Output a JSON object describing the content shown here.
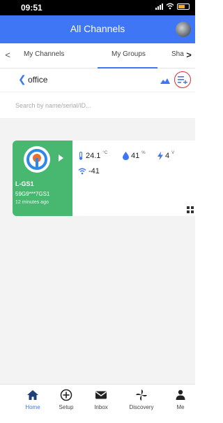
{
  "status_bar": {
    "time": "09:51"
  },
  "header": {
    "title": "All Channels"
  },
  "tabs": [
    {
      "label": "My Channels"
    },
    {
      "label": "My Groups"
    },
    {
      "label": "Sha"
    }
  ],
  "group": {
    "name": "office"
  },
  "search": {
    "placeholder": "Search by name/serial/ID..."
  },
  "device": {
    "name": "L-GS1",
    "serial": "59G9***7GS1",
    "updated": "12 minutes ago",
    "temperature": "24.1",
    "temperature_unit": "°C",
    "humidity": "41",
    "humidity_unit": "%",
    "voltage": "4",
    "voltage_unit": "V",
    "signal": "-41"
  },
  "nav": [
    {
      "label": "Home",
      "icon": "home-icon"
    },
    {
      "label": "Setup",
      "icon": "plus-circle-icon"
    },
    {
      "label": "Inbox",
      "icon": "envelope-icon"
    },
    {
      "label": "Discovery",
      "icon": "pinwheel-icon"
    },
    {
      "label": "Me",
      "icon": "person-icon"
    }
  ],
  "colors": {
    "accent": "#3e76f6",
    "device_card": "#48b871",
    "highlight_ring": "#d32f2f"
  }
}
